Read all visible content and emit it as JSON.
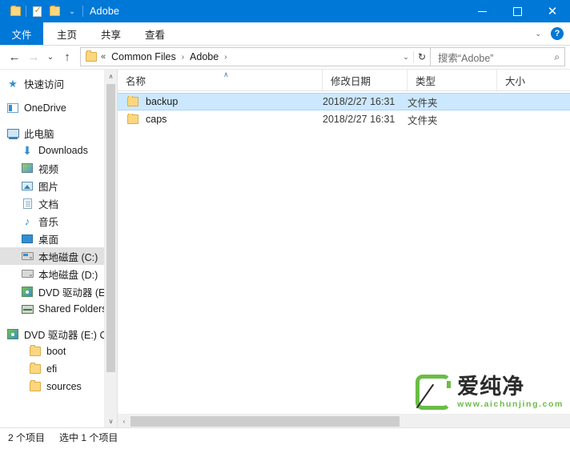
{
  "titlebar": {
    "title": "Adobe",
    "quick_access": [
      {
        "name": "folder-icon",
        "label": ""
      },
      {
        "name": "properties-icon",
        "label": ""
      },
      {
        "name": "new-folder-icon",
        "label": ""
      },
      {
        "name": "chevron-down-icon",
        "label": "⌄"
      }
    ],
    "minimize": "–",
    "maximize": "□",
    "close": "✕"
  },
  "ribbon": {
    "file_tab": "文件",
    "tabs": [
      "主页",
      "共享",
      "查看"
    ],
    "collapse": "⌄",
    "help": "?"
  },
  "address": {
    "back": "←",
    "forward": "→",
    "recent": "⌄",
    "up": "↑",
    "prefix": "«",
    "crumbs": [
      "Common Files",
      "Adobe"
    ],
    "separator": "›",
    "dropdown": "⌄",
    "refresh": "↻"
  },
  "search": {
    "placeholder": "搜索“Adobe”",
    "icon": "⌕"
  },
  "sidebar": {
    "scroll_up": "∧",
    "scroll_down": "∨",
    "items": [
      {
        "label": "快速访问",
        "icon": "star-icon",
        "indent": 0,
        "selected": false
      },
      {
        "label": "OneDrive",
        "icon": "onedrive-icon",
        "indent": 0,
        "selected": false
      },
      {
        "label": "此电脑",
        "icon": "this-pc-icon",
        "indent": 0,
        "selected": false
      },
      {
        "label": "Downloads",
        "icon": "downloads-icon",
        "indent": 1,
        "selected": false
      },
      {
        "label": "视频",
        "icon": "videos-icon",
        "indent": 1,
        "selected": false
      },
      {
        "label": "图片",
        "icon": "pictures-icon",
        "indent": 1,
        "selected": false
      },
      {
        "label": "文档",
        "icon": "documents-icon",
        "indent": 1,
        "selected": false
      },
      {
        "label": "音乐",
        "icon": "music-icon",
        "indent": 1,
        "selected": false
      },
      {
        "label": "桌面",
        "icon": "desktop-icon",
        "indent": 1,
        "selected": false
      },
      {
        "label": "本地磁盘 (C:)",
        "icon": "system-drive-icon",
        "indent": 1,
        "selected": true
      },
      {
        "label": "本地磁盘 (D:)",
        "icon": "drive-icon",
        "indent": 1,
        "selected": false
      },
      {
        "label": "DVD 驱动器 (E:)",
        "icon": "dvd-drive-icon",
        "indent": 1,
        "selected": false
      },
      {
        "label": "Shared Folders",
        "icon": "shared-folders-icon",
        "indent": 1,
        "selected": false
      },
      {
        "label": "DVD 驱动器 (E:) C",
        "icon": "dvd-drive-icon",
        "indent": 0,
        "selected": false
      },
      {
        "label": "boot",
        "icon": "folder-icon",
        "indent": 2,
        "selected": false
      },
      {
        "label": "efi",
        "icon": "folder-icon",
        "indent": 2,
        "selected": false
      },
      {
        "label": "sources",
        "icon": "folder-icon",
        "indent": 2,
        "selected": false
      }
    ]
  },
  "filelist": {
    "columns": [
      "名称",
      "修改日期",
      "类型",
      "大小"
    ],
    "sort_indicator": "∧",
    "rows": [
      {
        "name": "backup",
        "date": "2018/2/27 16:31",
        "type": "文件夹",
        "size": "",
        "selected": true
      },
      {
        "name": "caps",
        "date": "2018/2/27 16:31",
        "type": "文件夹",
        "size": "",
        "selected": false
      }
    ],
    "hscroll_left": "‹"
  },
  "statusbar": {
    "item_count": "2 个项目",
    "selection": "选中 1 个项目"
  },
  "watermark": {
    "brand": "爱纯净",
    "url": "www.aichunjing.com",
    "accent": "#6abd45"
  }
}
